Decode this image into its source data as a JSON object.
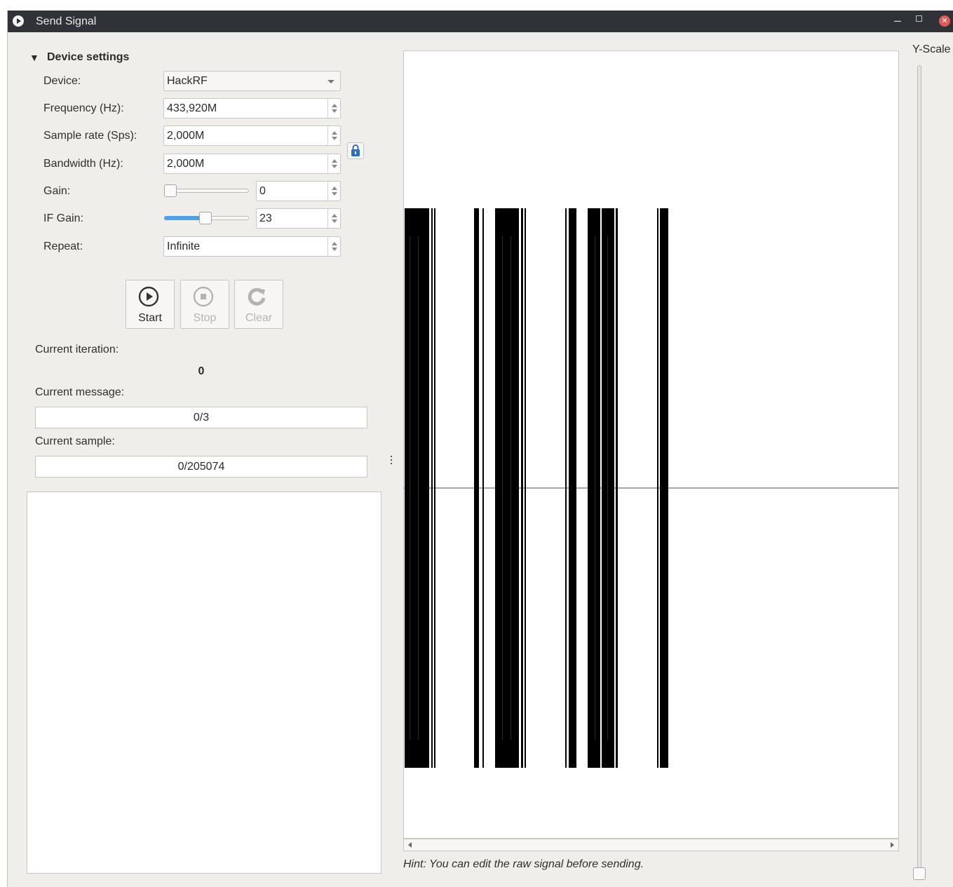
{
  "window": {
    "title": "Send Signal"
  },
  "device_settings": {
    "header": "Device settings",
    "device": {
      "label": "Device:",
      "value": "HackRF"
    },
    "frequency": {
      "label": "Frequency (Hz):",
      "value": "433,920M"
    },
    "sample_rate": {
      "label": "Sample rate (Sps):",
      "value": "2,000M"
    },
    "bandwidth": {
      "label": "Bandwidth (Hz):",
      "value": "2,000M"
    },
    "gain": {
      "label": "Gain:",
      "value": "0"
    },
    "if_gain": {
      "label": "IF Gain:",
      "value": "23"
    },
    "repeat": {
      "label": "Repeat:",
      "value": "Infinite"
    }
  },
  "controls": {
    "start": "Start",
    "stop": "Stop",
    "clear": "Clear"
  },
  "status": {
    "iteration_label": "Current iteration:",
    "iteration_value": "0",
    "message_label": "Current message:",
    "message_value": "0/3",
    "sample_label": "Current sample:",
    "sample_value": "0/205074"
  },
  "graph": {
    "yscale_label": "Y-Scale",
    "hint": "Hint: You can edit the raw signal before sending."
  },
  "colors": {
    "accent": "#4aa3e8",
    "titlebar": "#2f3237",
    "lock": "#2f6fc0"
  }
}
